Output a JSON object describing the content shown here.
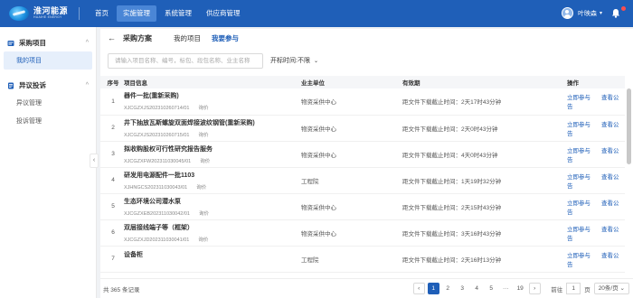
{
  "header": {
    "logo_cn": "淮河能源",
    "logo_en": "HUAIHE ENERGY",
    "nav": [
      {
        "label": "首页",
        "active": false
      },
      {
        "label": "实施管理",
        "active": true
      },
      {
        "label": "系统管理",
        "active": false
      },
      {
        "label": "供应商管理",
        "active": false
      }
    ],
    "user_name": "叶映森",
    "brand_color": "#1f5fb8",
    "notification_dot_color": "#ff4d4f"
  },
  "sidebar": {
    "groups": [
      {
        "title": "采购项目",
        "icon": "folder-icon",
        "items": [
          {
            "label": "我的项目",
            "active": true
          }
        ]
      },
      {
        "title": "异议投诉",
        "icon": "document-icon",
        "items": [
          {
            "label": "异议管理",
            "active": false
          },
          {
            "label": "投诉管理",
            "active": false
          }
        ]
      }
    ]
  },
  "page": {
    "title": "采购方案",
    "tabs": [
      {
        "label": "我的项目",
        "active": false
      },
      {
        "label": "我要参与",
        "active": true
      }
    ],
    "search_placeholder": "请输入项目名称、编号，标包、段包名称、业主名称",
    "date_filter": "开标时间:不限"
  },
  "table": {
    "headers": [
      "序号",
      "项目信息",
      "业主单位",
      "有效期",
      "操作"
    ],
    "rows": [
      {
        "no": "1",
        "name": "器件一批(重新采购)",
        "code": "XJCGZXJS202310260714/01",
        "bid": "询价",
        "owner": "物资采供中心",
        "validity": "距文件下载截止时间：2天17时43分钟",
        "actions": [
          "立即参与",
          "查看公告"
        ]
      },
      {
        "no": "2",
        "name": "井下抽放瓦斯螺旋双面焊接波纹钢管(重新采购)",
        "code": "XJCGZXJS202310260715/01",
        "bid": "询价",
        "owner": "物资采供中心",
        "validity": "距文件下载截止时间：2天0时43分钟",
        "actions": [
          "立即参与",
          "查看公告"
        ]
      },
      {
        "no": "3",
        "name": "拟收购股权可行性研究报告服务",
        "code": "XJCGZXFW202311030045/01",
        "bid": "询价",
        "owner": "物资采供中心",
        "validity": "距文件下载截止时间：4天0时43分钟",
        "actions": [
          "立即参与",
          "查看公告"
        ]
      },
      {
        "no": "4",
        "name": "研发用电源配件一批1103",
        "code": "XJHNGCS202311030043/01",
        "bid": "询价",
        "owner": "工程院",
        "validity": "距文件下载截止时间：1天19时32分钟",
        "actions": [
          "立即参与",
          "查看公告"
        ]
      },
      {
        "no": "5",
        "name": "生态环境公司潜水泵",
        "code": "XJCGZXEB202311030042/01",
        "bid": "询价",
        "owner": "物资采供中心",
        "validity": "距文件下载截止时间：2天15时43分钟",
        "actions": [
          "立即参与",
          "查看公告"
        ]
      },
      {
        "no": "6",
        "name": "双层接线端子等（框架）",
        "code": "XJCGZXJD202311030041/01",
        "bid": "询价",
        "owner": "物资采供中心",
        "validity": "距文件下载截止时间：3天16时43分钟",
        "actions": [
          "立即参与",
          "查看公告"
        ]
      },
      {
        "no": "7",
        "name": "设备柜",
        "code": "",
        "bid": "",
        "owner": "工程院",
        "validity": "距文件下载截止时间：2天16时13分钟",
        "actions": [
          "立即参与",
          "查看公告"
        ]
      }
    ]
  },
  "footer": {
    "total": "共 365 条记录",
    "pages": [
      "1",
      "2",
      "3",
      "4",
      "5",
      "···",
      "19"
    ],
    "current_page": "1",
    "goto_prefix": "前往",
    "goto_value": "1",
    "goto_suffix": "页",
    "page_size": "20条/页"
  }
}
